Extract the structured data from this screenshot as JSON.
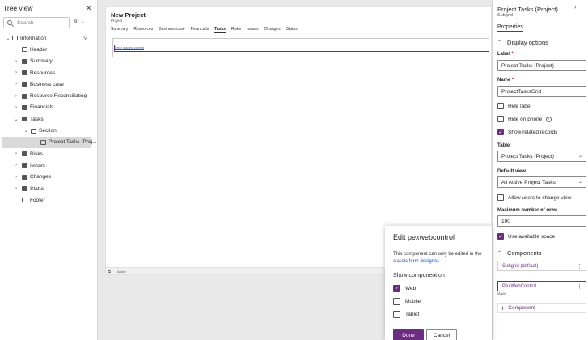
{
  "tree": {
    "title": "Tree view",
    "search_placeholder": "Search",
    "items": [
      {
        "label": "Information"
      },
      {
        "label": "Header"
      },
      {
        "label": "Summary"
      },
      {
        "label": "Resources"
      },
      {
        "label": "Business case"
      },
      {
        "label": "Resource Reconciliation"
      },
      {
        "label": "Financials"
      },
      {
        "label": "Tasks"
      },
      {
        "label": "Section"
      },
      {
        "label": "Project Tasks (Proj..."
      },
      {
        "label": "Risks"
      },
      {
        "label": "Issues"
      },
      {
        "label": "Changes"
      },
      {
        "label": "Status"
      },
      {
        "label": "Footer"
      }
    ]
  },
  "form": {
    "title": "New Project",
    "subtitle": "Project",
    "tabs": [
      "Summary",
      "Resources",
      "Business case",
      "Financials",
      "Tasks",
      "Risks",
      "Issues",
      "Changes",
      "Status"
    ],
    "active_tab": "Tasks",
    "grid_error": "Error loading control",
    "status": "Active"
  },
  "properties": {
    "title": "Project Tasks (Project)",
    "subtitle": "Subgrid",
    "tab": "Properties",
    "display_options": "Display options",
    "label_label": "Label",
    "label_value": "Project Tasks (Project)",
    "name_label": "Name",
    "name_value": "ProjectTasksGrid",
    "hide_label": "Hide label",
    "hide_on_phone": "Hide on phone",
    "show_related": "Show related records",
    "table_label": "Table",
    "table_value": "Project Tasks (Project)",
    "default_view_label": "Default view",
    "default_view_value": "All Active Project Tasks",
    "allow_change_view": "Allow users to change view",
    "max_rows_label": "Maximum number of rows",
    "max_rows_value": "100",
    "use_available_space": "Use available space",
    "components_label": "Components",
    "component_1": "Subgrid (default)",
    "component_2": "PexWebControl",
    "component_2_sub": "Web",
    "add_component": "Component"
  },
  "dialog": {
    "title": "Edit pexwebcontrol",
    "text_1": "This component can only be edited in the",
    "link": "classic form designer",
    "text_2": ".",
    "show_on": "Show component on",
    "opt_web": "Web",
    "opt_mobile": "Mobile",
    "opt_tablet": "Tablet",
    "done": "Done",
    "cancel": "Cancel"
  },
  "colors": {
    "accent": "#6b2d82",
    "link": "#1a55c7"
  }
}
